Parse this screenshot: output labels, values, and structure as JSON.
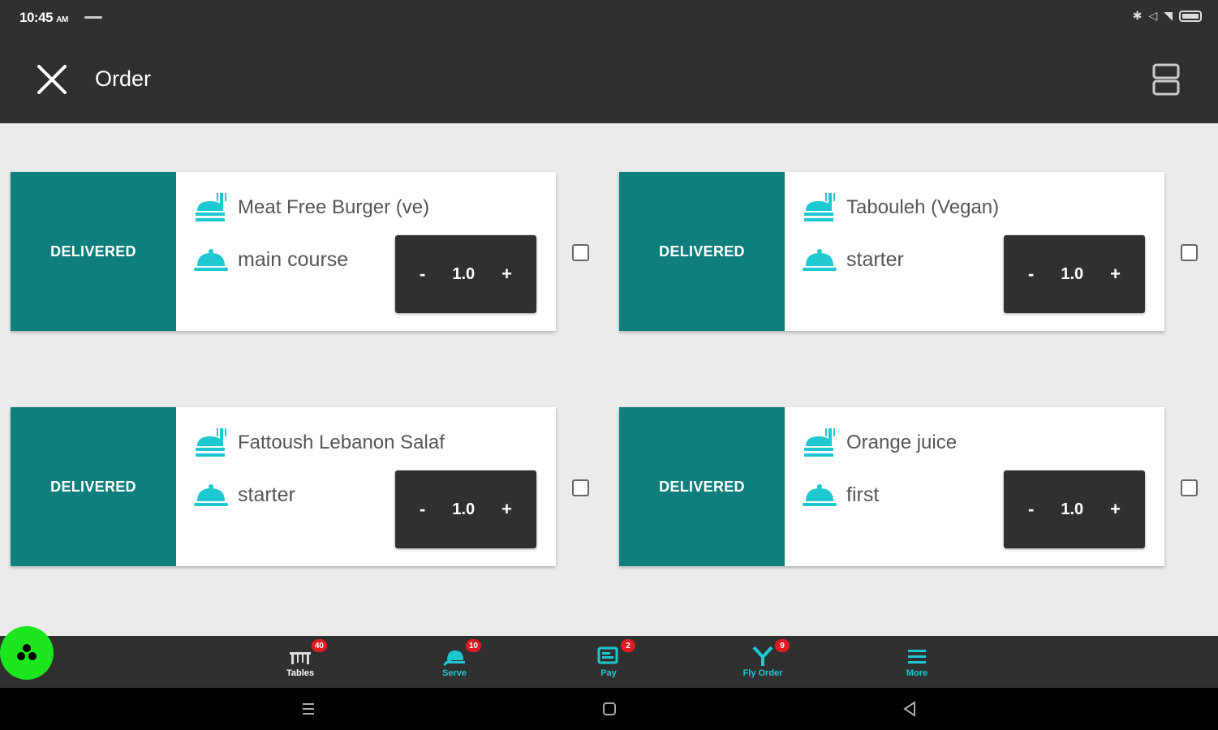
{
  "status_bar": {
    "time": "10:45",
    "ampm": "AM"
  },
  "app_bar": {
    "title": "Order"
  },
  "orders": [
    {
      "status": "DELIVERED",
      "name": "Meat Free Burger (ve)",
      "course": "main course",
      "quantity": "1.0",
      "minus": "-",
      "plus": "+"
    },
    {
      "status": "DELIVERED",
      "name": "Tabouleh (Vegan)",
      "course": "starter",
      "quantity": "1.0",
      "minus": "-",
      "plus": "+"
    },
    {
      "status": "DELIVERED",
      "name": "Fattoush Lebanon Salaf",
      "course": "starter",
      "quantity": "1.0",
      "minus": "-",
      "plus": "+"
    },
    {
      "status": "DELIVERED",
      "name": "Orange juice",
      "course": "first",
      "quantity": "1.0",
      "minus": "-",
      "plus": "+"
    }
  ],
  "bottom_nav": [
    {
      "label": "Tables",
      "badge": "40",
      "icon": "tables-icon"
    },
    {
      "label": "Serve",
      "badge": "10",
      "icon": "serve-icon"
    },
    {
      "label": "Pay",
      "badge": "2",
      "icon": "pay-icon"
    },
    {
      "label": "Fly Order",
      "badge": "9",
      "icon": "fly-order-icon"
    },
    {
      "label": "More",
      "badge": "",
      "icon": "menu-icon"
    }
  ],
  "colors": {
    "bar": "#303030",
    "delivered": "#0f7f7d",
    "accent": "#1ec8d0",
    "badge": "#e01b24",
    "fab": "#1ee61e"
  }
}
